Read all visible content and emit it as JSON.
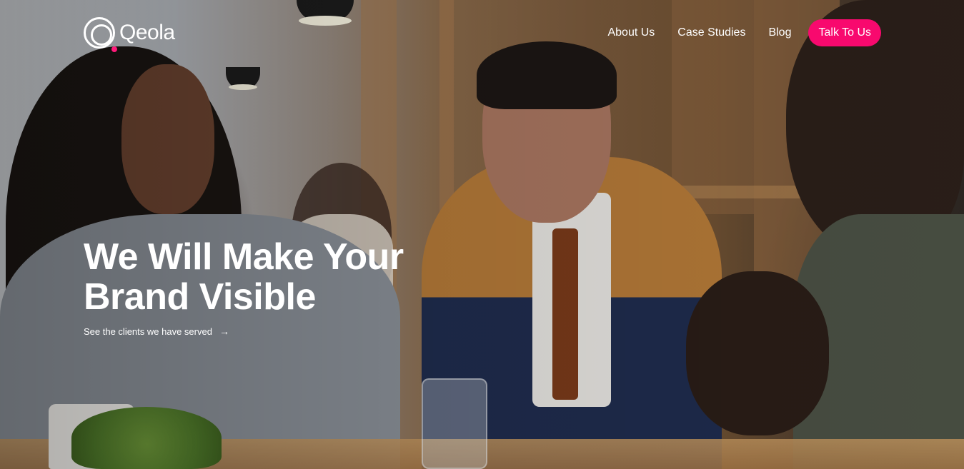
{
  "brand": {
    "name": "Qeola",
    "logo_icon": "qeola-logo-icon",
    "accent_color": "#f8096e"
  },
  "nav": {
    "items": [
      {
        "label": "About Us"
      },
      {
        "label": "Case Studies"
      },
      {
        "label": "Blog"
      }
    ],
    "cta_label": "Talk To Us"
  },
  "hero": {
    "headline_line1": "We Will Make Your",
    "headline_line2": "Brand Visible",
    "link_label": "See the clients we have served",
    "link_icon": "arrow-right-icon",
    "link_arrow": "→"
  }
}
